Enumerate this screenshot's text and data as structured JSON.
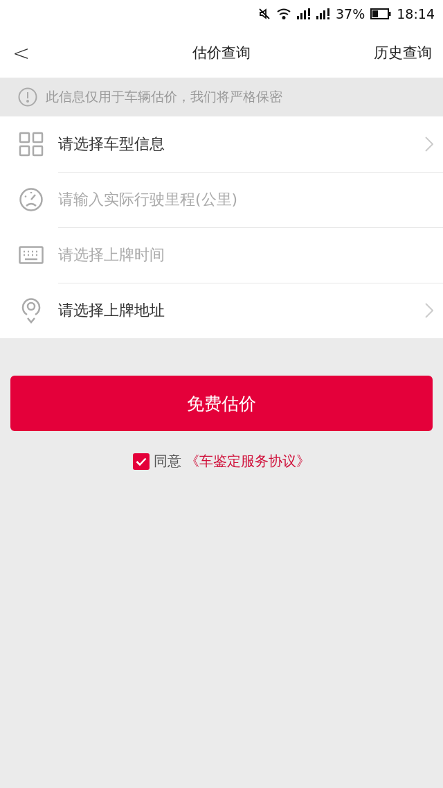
{
  "status_bar": {
    "battery": "37%",
    "time": "18:14"
  },
  "header": {
    "back": "<",
    "title": "估价查询",
    "action": "历史查询"
  },
  "notice": {
    "text": "此信息仅用于车辆估价，我们将严格保密"
  },
  "form_rows": [
    {
      "kind": "select",
      "label": "请选择车型信息"
    },
    {
      "kind": "input",
      "placeholder": "请输入实际行驶里程(公里)"
    },
    {
      "kind": "input",
      "placeholder": "请选择上牌时间"
    },
    {
      "kind": "select",
      "label": "请选择上牌地址"
    }
  ],
  "submit_button": "免费估价",
  "agreement": {
    "checked": true,
    "text": "同意",
    "link": "《车鉴定服务协议》"
  }
}
